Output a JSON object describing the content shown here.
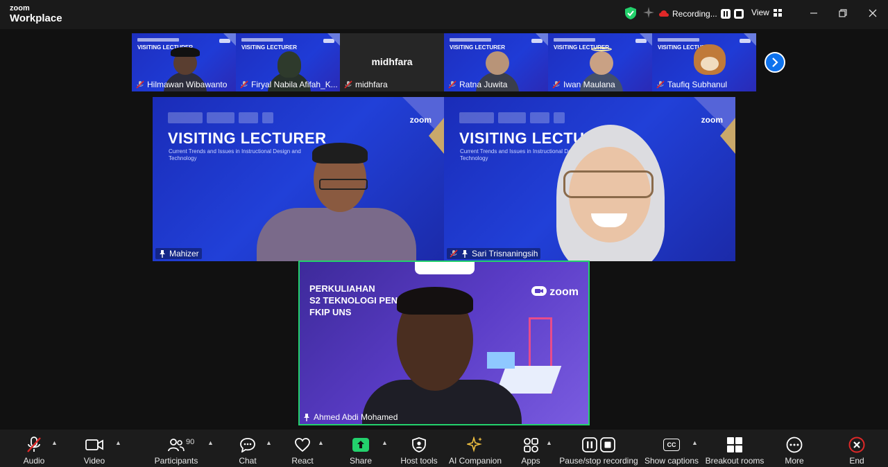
{
  "app": {
    "logo_top": "zoom",
    "logo_bottom": "Workplace"
  },
  "titlebar": {
    "recording_label": "Recording...",
    "view_label": "View"
  },
  "strip": {
    "participants": [
      {
        "name": "Hilmawan Wibawanto",
        "muted": true,
        "slide_title": "VISITING LECTURER"
      },
      {
        "name": "Firyal Nabila Afifah_K...",
        "muted": true,
        "slide_title": "VISITING LECTURER"
      },
      {
        "name": "midhfara",
        "muted": true,
        "big_name": "midhfara"
      },
      {
        "name": "Ratna Juwita",
        "muted": true,
        "slide_title": "VISITING LECTURER"
      },
      {
        "name": "Iwan Maulana",
        "muted": true,
        "slide_title": "VISITING LECTURER"
      },
      {
        "name": "Taufiq Subhanul",
        "muted": true,
        "slide_title": "VISITING LECTURER"
      }
    ]
  },
  "tiles": {
    "left": {
      "name": "Mahizer",
      "slide_title": "VISITING LECTURER",
      "slide_sub": "Current Trends and Issues in Instructional Design and Technology",
      "zoom": "zoom"
    },
    "right": {
      "name": "Sari Trisnaningsih",
      "slide_title": "VISITING LECTURER",
      "slide_sub": "Current Trends and Issues in Instructional Design and Technology",
      "zoom": "zoom"
    },
    "bottom": {
      "name": "Ahmed Abdi Mohamed",
      "line1": "PERKULIAHAN",
      "line2": "S2 TEKNOLOGI PEND",
      "line3": "FKIP UNS",
      "zoom": "zoom"
    }
  },
  "toolbar": {
    "audio": "Audio",
    "video": "Video",
    "participants": "Participants",
    "participants_count": "90",
    "chat": "Chat",
    "react": "React",
    "share": "Share",
    "host_tools": "Host tools",
    "ai_companion": "AI Companion",
    "apps": "Apps",
    "pause_stop": "Pause/stop recording",
    "captions": "Show captions",
    "captions_icon": "CC",
    "breakout": "Breakout rooms",
    "more": "More",
    "end": "End"
  },
  "colors": {
    "accent_blue": "#0e72ed",
    "share_green": "#23d16c",
    "end_red": "#e02828",
    "mute_red": "#e02828"
  }
}
